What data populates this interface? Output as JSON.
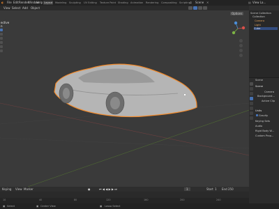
{
  "menubar": {
    "file": "File",
    "edit": "Edit",
    "render": "Render",
    "window": "Window",
    "help": "Help",
    "tabs": [
      "Layout",
      "Modeling",
      "Sculpting",
      "UV Editing",
      "Texture Paint",
      "Shading",
      "Animation",
      "Rendering",
      "Compositing",
      "Scripting"
    ],
    "scene_label": "Scene",
    "view_layer_label": "View La..."
  },
  "viewport": {
    "header_left": [
      "View",
      "Select",
      "Add",
      "Object"
    ],
    "overlay_line1": "ective",
    "overlay_line2": "n",
    "options_label": "Options"
  },
  "outliner": {
    "title": "Scene Collection",
    "items": [
      "Collection",
      "Camera",
      "Light",
      "Cube"
    ]
  },
  "properties": {
    "header": "Scene",
    "section_scene": "Scene",
    "rows": [
      "Camera",
      "Background...",
      "Active Clip"
    ],
    "section_units": "Units",
    "gravity": "Gravity",
    "other_sections": [
      "Keying Sets",
      "Audio",
      "Rigid Body W...",
      "Custom Prop..."
    ]
  },
  "timeline": {
    "playback": "Keying",
    "view": "View",
    "marker": "Marker",
    "frame_current": "1",
    "start_label": "Start",
    "start_value": "1",
    "end_label": "End",
    "end_value": "250",
    "ticks": [
      "10",
      "40",
      "80",
      "120",
      "160",
      "200",
      "240"
    ]
  },
  "statusbar": {
    "select": "Select",
    "center_view": "Center View",
    "lasso": "Lasso Select"
  },
  "colors": {
    "accent_blue": "#4772b3",
    "selection_orange": "#f28a2b",
    "viewport_bg": "#3a3a3a"
  }
}
